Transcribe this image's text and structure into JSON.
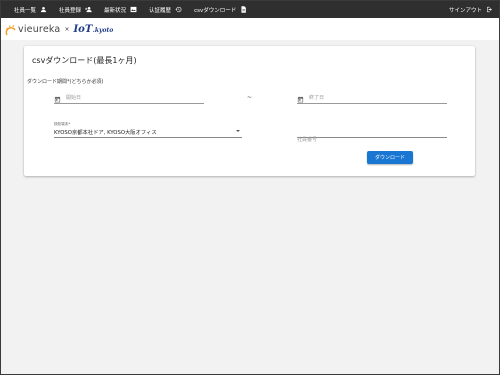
{
  "nav": {
    "items": [
      {
        "label": "社員一覧",
        "icon": "person-icon"
      },
      {
        "label": "社員登録",
        "icon": "person-add-icon"
      },
      {
        "label": "最新状況",
        "icon": "image-icon"
      },
      {
        "label": "认証履歴",
        "icon": "history-icon"
      },
      {
        "label": "csvダウンロード",
        "icon": "file-icon"
      }
    ],
    "signout": {
      "label": "サインアウト",
      "icon": "logout-icon"
    }
  },
  "logo": {
    "vieureka": "vieureka",
    "times": "×",
    "iot_main": "IoT",
    "iot_sub": ".kyoto",
    "brand_color": "#1f3b8a",
    "sun_color": "#f29c1f"
  },
  "card": {
    "title": "csvダウンロード(最長1ヶ月)",
    "section_label": "ダウンロード期間*(どちらか必須)",
    "start_date_placeholder": "開始日",
    "range_separator": "~",
    "end_date_placeholder": "終了日",
    "device_select": {
      "label": "検知端末*",
      "value": "KYOSO京都本社ドア, KYOSO大阪オフィス"
    },
    "employee_number_placeholder": "社員番号",
    "download_button": "ダウンロード",
    "accent_color": "#1976d2"
  },
  "colors": {
    "nav_bg": "#2f2f2f",
    "page_bg": "#f2f2f2"
  }
}
